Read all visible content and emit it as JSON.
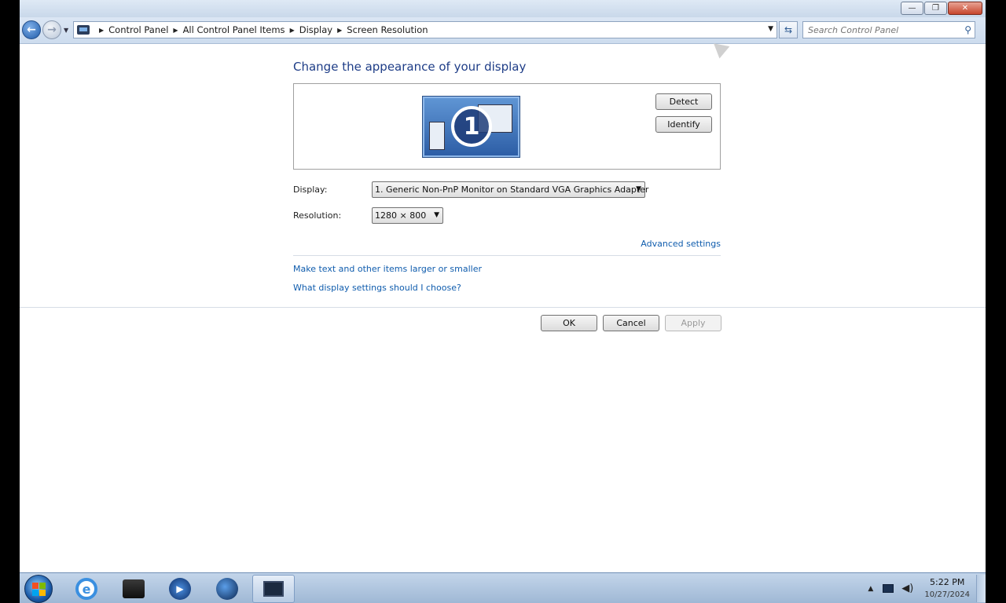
{
  "window": {
    "minimize_glyph": "—",
    "maximize_glyph": "❐",
    "close_glyph": "✕"
  },
  "address_bar": {
    "breadcrumbs": [
      "Control Panel",
      "All Control Panel Items",
      "Display",
      "Screen Resolution"
    ],
    "search_placeholder": "Search Control Panel"
  },
  "page": {
    "title": "Change the appearance of your display",
    "monitor_number": "1",
    "detect_label": "Detect",
    "identify_label": "Identify",
    "display_label": "Display:",
    "display_value": "1. Generic Non-PnP Monitor on Standard VGA Graphics Adapter",
    "resolution_label": "Resolution:",
    "resolution_value": "1280 × 800",
    "advanced_link": "Advanced settings",
    "text_size_link": "Make text and other items larger or smaller",
    "help_link": "What display settings should I choose?",
    "ok_label": "OK",
    "cancel_label": "Cancel",
    "apply_label": "Apply"
  },
  "taskbar": {
    "items": [
      "start",
      "internet-explorer",
      "folder",
      "media-player",
      "globe",
      "display-settings"
    ],
    "clock_time": "5:22 PM",
    "clock_date": "10/27/2024"
  },
  "colors": {
    "title_blue": "#1e3d87",
    "link_blue": "#0f5cad",
    "taskbar": "#b4c9e2"
  }
}
